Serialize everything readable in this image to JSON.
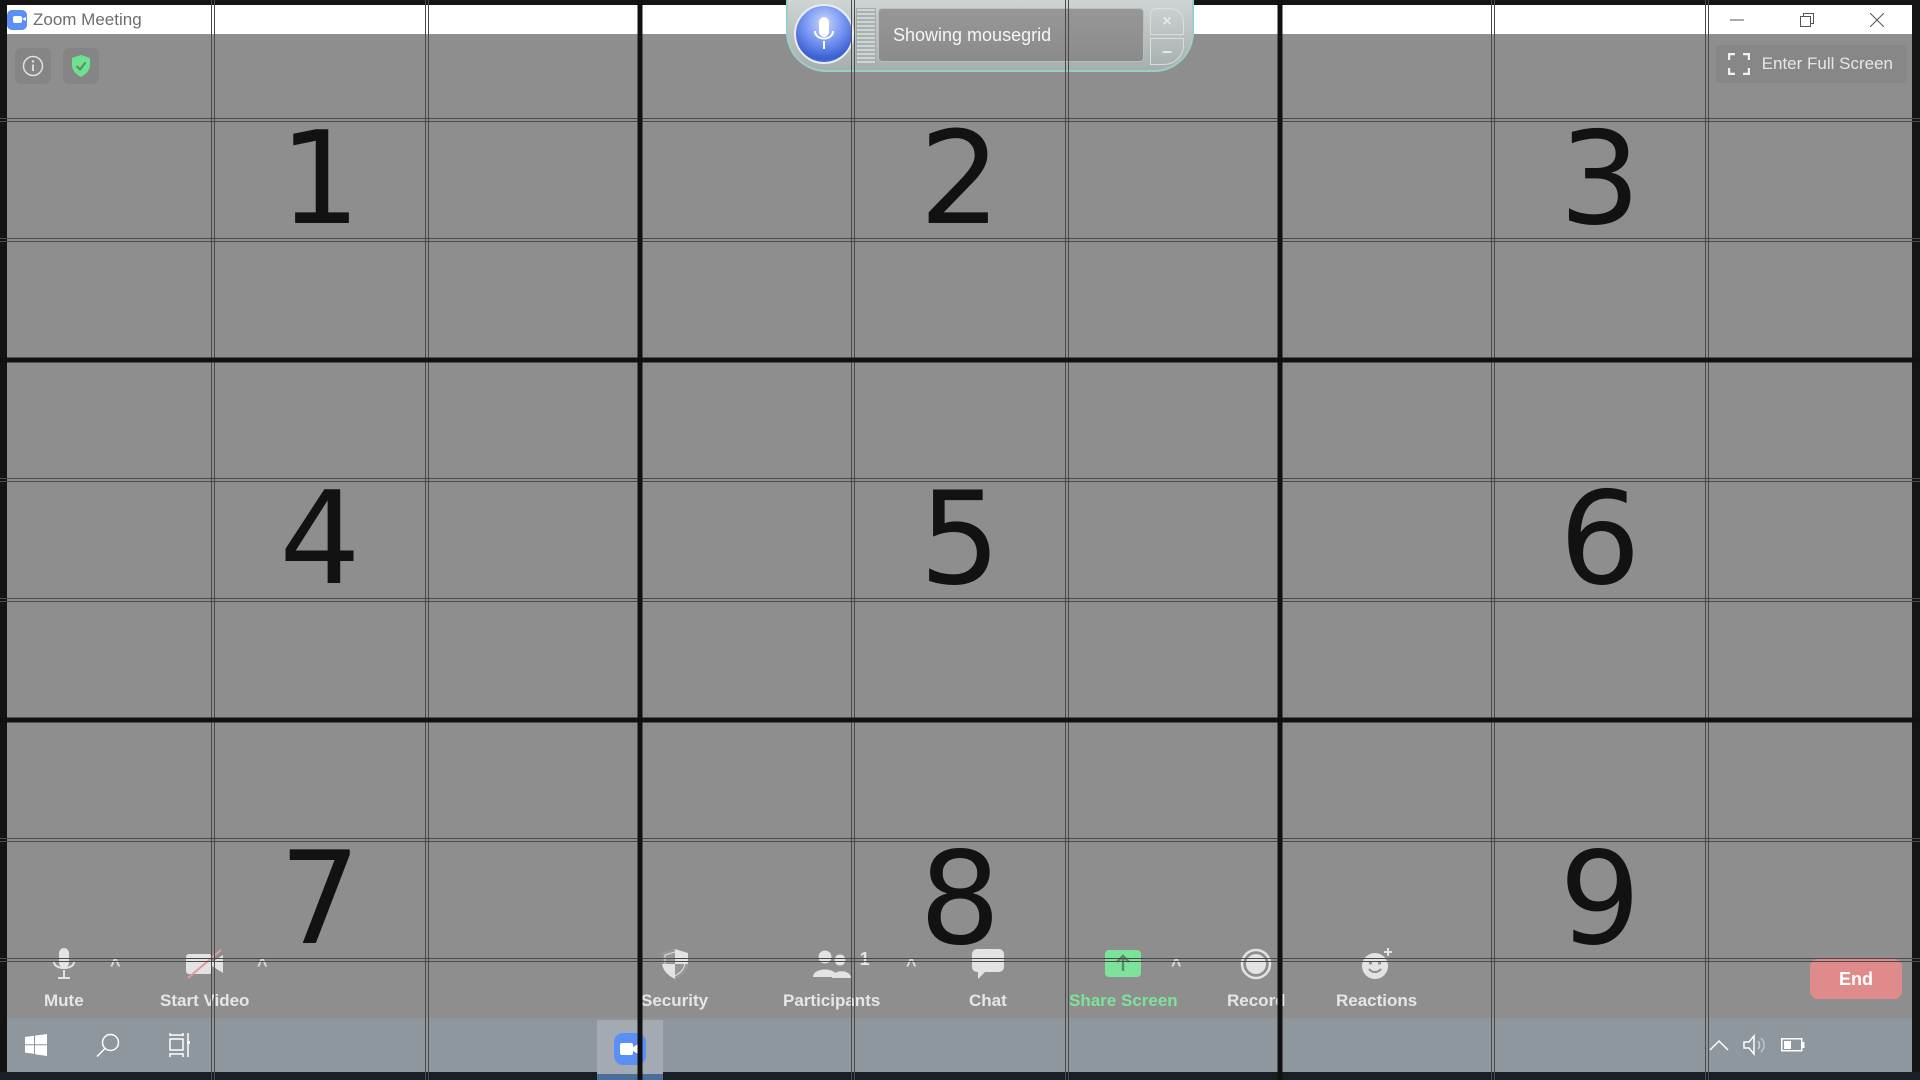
{
  "window": {
    "title": "Zoom Meeting",
    "controls": {
      "minimize": "minimize-icon",
      "restore": "restore-icon",
      "close": "close-icon"
    }
  },
  "meeting_top": {
    "info_icon": "info-icon",
    "encryption_icon": "shield-check-icon",
    "fullscreen_label": "Enter Full Screen"
  },
  "toolbar": {
    "mute_label": "Mute",
    "start_video_label": "Start Video",
    "security_label": "Security",
    "participants_label": "Participants",
    "participants_count": "1",
    "chat_label": "Chat",
    "share_screen_label": "Share Screen",
    "record_label": "Record",
    "reactions_label": "Reactions",
    "end_label": "End",
    "caret": "^"
  },
  "speech_widget": {
    "status_text": "Showing mousegrid",
    "close_glyph": "×",
    "minimize_glyph": "–"
  },
  "mousegrid": {
    "numbers": [
      "1",
      "2",
      "3",
      "4",
      "5",
      "6",
      "7",
      "8",
      "9"
    ]
  },
  "colors": {
    "share_green": "#7ee39a",
    "end_red": "#e08b8b",
    "zoom_blue": "#5a8ff5",
    "shield_green": "#6fe08f"
  },
  "taskbar": {
    "start_icon": "windows-start-icon",
    "search_icon": "search-icon",
    "task_view_icon": "task-view-icon",
    "pinned": [
      "zoom-app-icon"
    ],
    "tray": [
      "chevron-up-icon",
      "volume-icon",
      "battery-icon"
    ]
  }
}
